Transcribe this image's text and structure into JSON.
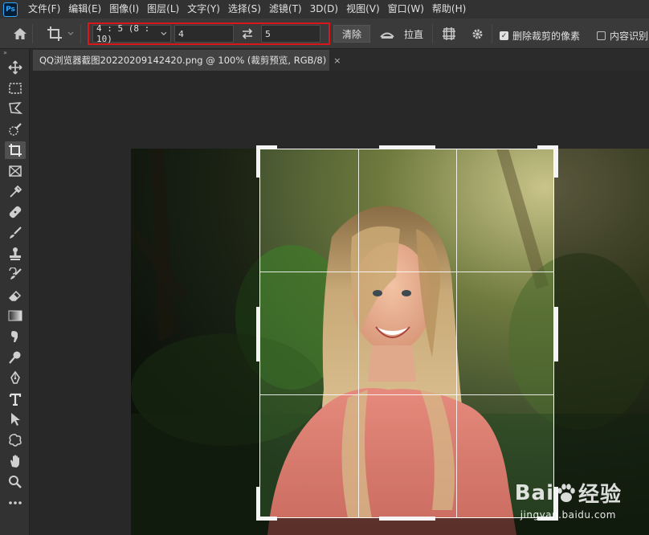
{
  "app": {
    "logo": "Ps"
  },
  "menu": [
    "文件(F)",
    "编辑(E)",
    "图像(I)",
    "图层(L)",
    "文字(Y)",
    "选择(S)",
    "滤镜(T)",
    "3D(D)",
    "视图(V)",
    "窗口(W)",
    "帮助(H)"
  ],
  "options": {
    "ratio_preset": "4 : 5 (8 : 10)",
    "ratio_width": "4",
    "ratio_height": "5",
    "clear_label": "清除",
    "straighten_label": "拉直",
    "delete_cropped_label": "删除裁剪的像素",
    "delete_cropped_checked": true,
    "content_aware_label": "内容识别",
    "content_aware_checked": false
  },
  "tools": [
    "move",
    "marquee",
    "lasso",
    "quick-select",
    "crop",
    "frame",
    "eyedropper",
    "healing",
    "brush",
    "stamp",
    "history-brush",
    "eraser",
    "gradient",
    "smudge",
    "dodge",
    "pen",
    "type",
    "path-select",
    "shape",
    "hand",
    "zoom",
    "more"
  ],
  "active_tool": "crop",
  "document": {
    "tab_title": "QQ浏览器截图20220209142420.png @ 100% (裁剪预览, RGB/8)",
    "close_symbol": "×"
  },
  "watermark": {
    "brand_left": "Bai",
    "brand_right": "经验",
    "url": "jingyan.baidu.com"
  },
  "colors": {
    "highlight_border": "#d8161c",
    "ps_blue": "#31a8ff"
  }
}
